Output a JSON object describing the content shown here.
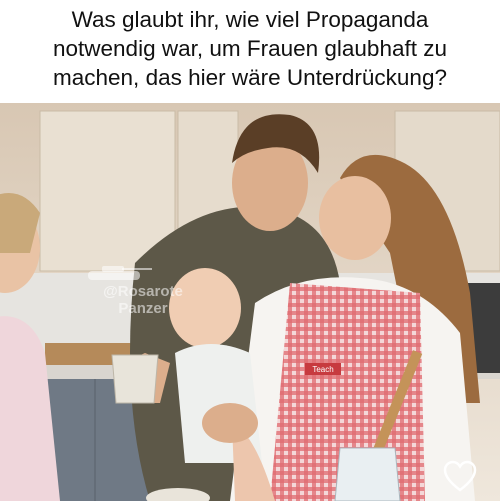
{
  "caption": {
    "text": "Was glaubt ihr, wie viel Propaganda\nnotwendig war, um Frauen glaubhaft zu\nmachen, das hier wäre Unterdrückung?"
  },
  "watermark": {
    "line1": "@Rosarote",
    "line2": "Panzer"
  },
  "apron_label": "Teach",
  "icons": [
    "tank-icon",
    "heart-icon"
  ],
  "colors": {
    "apron": "#d9434a",
    "kitchen_wall": "#e8ddd0",
    "man_shirt": "#5d5848"
  }
}
